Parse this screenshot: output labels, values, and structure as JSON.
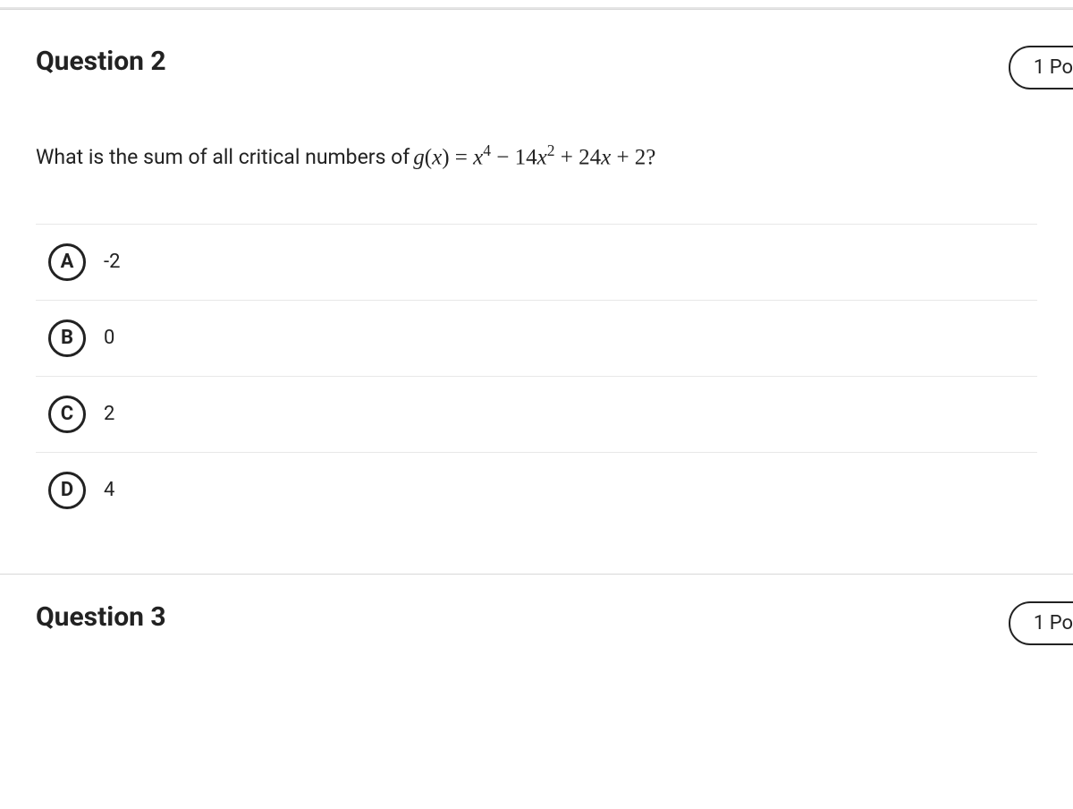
{
  "question2": {
    "title": "Question 2",
    "points": "1 Po",
    "prompt_pre": "What is the sum of all critical numbers of ",
    "prompt_math_g": "g",
    "prompt_math_x": "x",
    "prompt_math_eq": " = ",
    "prompt_math_expr1": "x",
    "prompt_math_sup1": "4",
    "prompt_math_minus": " − 14",
    "prompt_math_expr2": "x",
    "prompt_math_sup2": "2",
    "prompt_math_plus": " + 24",
    "prompt_math_expr3": "x",
    "prompt_math_end": " + 2?",
    "choices": [
      {
        "letter": "A",
        "text": "-2"
      },
      {
        "letter": "B",
        "text": "0"
      },
      {
        "letter": "C",
        "text": "2"
      },
      {
        "letter": "D",
        "text": "4"
      }
    ]
  },
  "question3": {
    "title": "Question 3",
    "points": "1 Po"
  }
}
